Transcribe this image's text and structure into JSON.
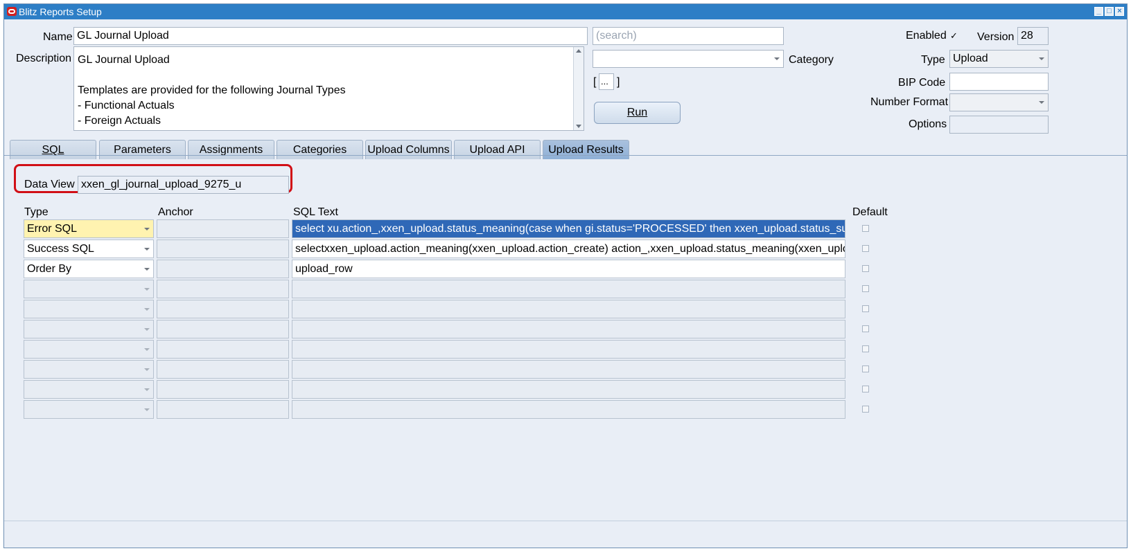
{
  "window": {
    "title": "Blitz Reports Setup",
    "controls": [
      "minimize",
      "maximize",
      "close"
    ]
  },
  "header": {
    "name_label": "Name",
    "name_value": "GL Journal Upload",
    "search_placeholder": "(search)",
    "description_label": "Description",
    "description_lines": [
      "GL Journal Upload",
      "",
      "Templates are provided for the following Journal Types",
      "- Functional Actuals",
      "- Foreign Actuals"
    ],
    "category_label": "Category",
    "category_value": "",
    "ellipsis_open": "[",
    "ellipsis_button": "...",
    "ellipsis_close": "]",
    "run_label": "Run",
    "enabled_label": "Enabled",
    "enabled_checked": true,
    "enabled_mark": "✓",
    "version_label": "Version",
    "version_value": "28",
    "type_label": "Type",
    "type_value": "Upload",
    "bip_code_label": "BIP Code",
    "bip_code_value": "",
    "number_format_label": "Number Format",
    "number_format_value": "",
    "options_label": "Options",
    "options_value": ""
  },
  "tabs": [
    {
      "label": "SQL",
      "active": false
    },
    {
      "label": "Parameters",
      "active": false
    },
    {
      "label": "Assignments",
      "active": false
    },
    {
      "label": "Categories",
      "active": false
    },
    {
      "label": "Upload Columns",
      "active": false
    },
    {
      "label": "Upload API",
      "active": false
    },
    {
      "label": "Upload Results",
      "active": true
    }
  ],
  "upload_results": {
    "data_view_label": "Data View",
    "data_view_value": "xxen_gl_journal_upload_9275_u",
    "columns": {
      "type": "Type",
      "anchor": "Anchor",
      "sql_text": "SQL Text",
      "default": "Default"
    },
    "rows": [
      {
        "type": "Error SQL",
        "anchor": "",
        "sql_text": "select xu.action_,xxen_upload.status_meaning(case when gi.status='PROCESSED' then xxen_upload.status_succe",
        "default": false
      },
      {
        "type": "Success SQL",
        "anchor": "",
        "sql_text": "selectxxen_upload.action_meaning(xxen_upload.action_create) action_,xxen_upload.status_meaning(xxen_upload.s",
        "default": false
      },
      {
        "type": "Order By",
        "anchor": "",
        "sql_text": "upload_row",
        "default": false
      },
      {
        "type": "",
        "anchor": "",
        "sql_text": "",
        "default": false
      },
      {
        "type": "",
        "anchor": "",
        "sql_text": "",
        "default": false
      },
      {
        "type": "",
        "anchor": "",
        "sql_text": "",
        "default": false
      },
      {
        "type": "",
        "anchor": "",
        "sql_text": "",
        "default": false
      },
      {
        "type": "",
        "anchor": "",
        "sql_text": "",
        "default": false
      },
      {
        "type": "",
        "anchor": "",
        "sql_text": "",
        "default": false
      },
      {
        "type": "",
        "anchor": "",
        "sql_text": "",
        "default": false
      }
    ]
  },
  "colors": {
    "titlebar": "#2d7ec6",
    "window_bg": "#e9eef6",
    "highlight_border": "#d10f16",
    "selected_cell": "#2f68b7",
    "current_cell": "#fff3b0"
  }
}
